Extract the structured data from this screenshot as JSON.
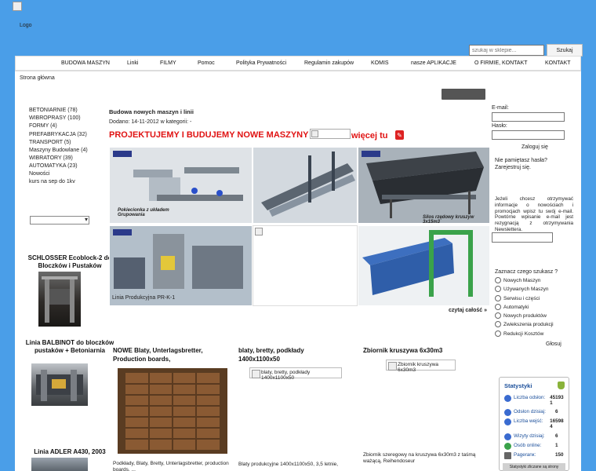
{
  "header": {
    "logo_text": "Logo",
    "search_placeholder": "szukaj w sklepie...",
    "search_button": "Szukaj"
  },
  "nav": {
    "items": [
      "BUDOWA MASZYN",
      "Linki",
      "FILMY",
      "Pomoc",
      "Polityka Prywatności",
      "Regulamin zakupów",
      "KOMIS",
      "nasze APLIKACJE",
      "O FIRMIE, KONTAKT",
      "KONTAKT"
    ]
  },
  "breadcrumb": "Strona główna",
  "sidebar_left": {
    "categories": [
      "BETONIARNIE  (78)",
      "WIBROPRASY  (100)",
      "FORMY  (4)",
      "PREFABRYKACJA  (32)",
      "TRANSPORT  (5)",
      "Maszyny Budowlane  (4)",
      "WIBRATORY  (39)",
      "AUTOMATYKA  (23)",
      "Nowości",
      "kurs na sep do 1kv"
    ],
    "promos": [
      {
        "title": "SCHLOSSER Ecoblock-2 do Bloczków i Pustaków"
      },
      {
        "title": "Linia BALBINOT do bloczków pustaków + Betoniarnia"
      },
      {
        "title": "Linia ADLER A430, 2003"
      }
    ]
  },
  "article": {
    "title": "Budowa nowych maszyn i linii",
    "meta": "Dodano: 14-11-2012 w kategorii:  -",
    "banner_text": "PROJEKTUJEMY I BUDUJEMY NOWE MASZYNY",
    "more_link": "więcej tu",
    "pdf_icon": "pdf-icon",
    "gallery_captions": [
      "Pokiecionka z układem Grupowania",
      "Silos rzędowy kruszyw 3x15m3",
      "Linia Produkcyjna PR-K-1"
    ],
    "read_all": "czytaj całość »"
  },
  "products": [
    {
      "title": "NOWE Blaty, Unterlagsbretter, Production boards,",
      "desc": "Podkłady, Blaty, Bretty, Unterlagsbretter, production boards, ...",
      "image": "photo"
    },
    {
      "title": "blaty, bretty, podkłady 1400x1100x50",
      "image_alt": "blaty, bretty, podkłady 1400x1100x50",
      "desc": "Blaty produkcyjne 1400x1100x50, 3,5 letnie,"
    },
    {
      "title": "Zbiornik kruszywa 6x30m3",
      "image_alt": "Zbiornik kruszywa 6x30m3",
      "desc": "Zbiornik szeregowy na kruszywa 6x30m3 z taśmą ważącą, Reihendoseur"
    }
  ],
  "sidebar_right": {
    "email_label": "E-mail:",
    "password_label": "Hasło:",
    "login_button": "Zaloguj się",
    "forgot_link": "Nie pamiętasz hasła?",
    "register_link": "Zarejestruj się.",
    "newsletter_text": "Jeżeli chcesz otrzymywać informacje o nowościach i promocjach wpisz tu swój e-mail. Powtórne wpisanie e-mail jest rezygnacją z otrzymywania Newslettera.",
    "poll_title": "Zaznacz czego szukasz ?",
    "poll_options": [
      "Nowych Maszyn",
      "Używanych Maszyn",
      "Serwisu i części",
      "Automatyki",
      "Nowych produktów",
      "Zwiekszenia produkcji",
      "Redukcji Kosztów"
    ],
    "vote_button": "Głosuj"
  },
  "stats": {
    "title": "Statystyki",
    "rows": [
      {
        "label": "Liczba odsłon:",
        "value": "45193 1"
      },
      {
        "label": "Odsłon dzisiaj:",
        "value": "6"
      },
      {
        "label": "Liczba wejść:",
        "value": "16598 4"
      },
      {
        "label": "Wizyty dzisiaj:",
        "value": "6"
      },
      {
        "label": "Osób online:",
        "value": "1"
      },
      {
        "label": "Pageranк:",
        "value": "150"
      }
    ],
    "footer": "Statystyki zliczane są strony"
  },
  "colors": {
    "background": "#4a9ee8",
    "banner_red": "#e01212",
    "stats_blue": "#1a4e9a"
  }
}
